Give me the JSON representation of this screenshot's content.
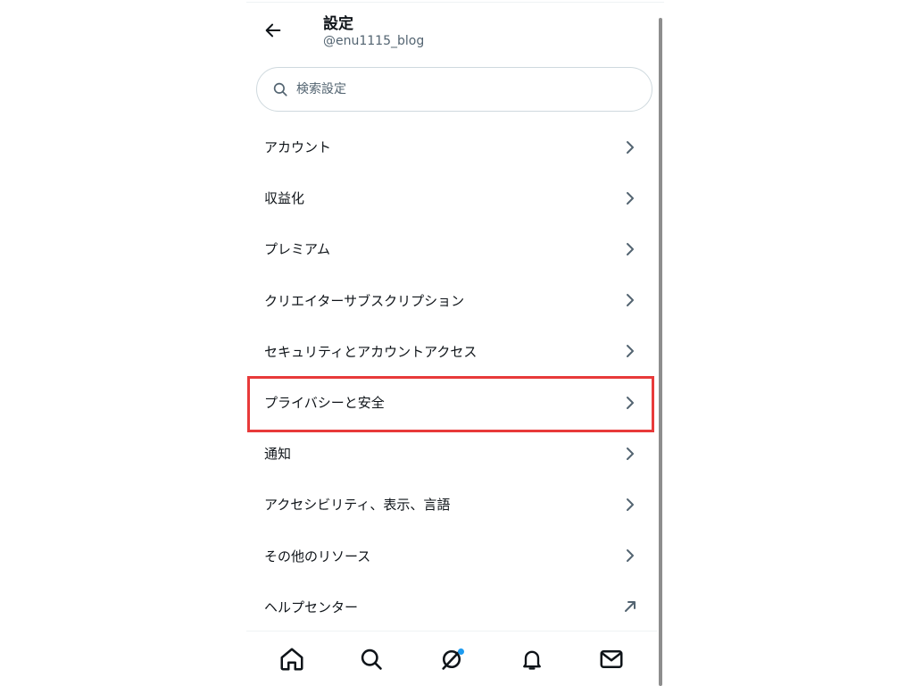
{
  "header": {
    "title": "設定",
    "handle": "@enu1115_blog"
  },
  "search": {
    "placeholder": "検索設定"
  },
  "menu": {
    "items": [
      {
        "label": "アカウント",
        "icon": "chevron-right-icon"
      },
      {
        "label": "収益化",
        "icon": "chevron-right-icon"
      },
      {
        "label": "プレミアム",
        "icon": "chevron-right-icon"
      },
      {
        "label": "クリエイターサブスクリプション",
        "icon": "chevron-right-icon"
      },
      {
        "label": "セキュリティとアカウントアクセス",
        "icon": "chevron-right-icon"
      },
      {
        "label": "プライバシーと安全",
        "icon": "chevron-right-icon",
        "highlighted": true
      },
      {
        "label": "通知",
        "icon": "chevron-right-icon"
      },
      {
        "label": "アクセシビリティ、表示、言語",
        "icon": "chevron-right-icon"
      },
      {
        "label": "その他のリソース",
        "icon": "chevron-right-icon"
      },
      {
        "label": "ヘルプセンター",
        "icon": "external-link-arrow-icon"
      }
    ]
  },
  "bottom_nav": {
    "items": [
      "home-icon",
      "search-icon",
      "grok-icon",
      "bell-icon",
      "mail-icon"
    ],
    "notification_dot_on": "grok-icon"
  },
  "colors": {
    "highlight_border": "#e83a3a",
    "accent": "#1d9bf0",
    "text": "#0f1419",
    "secondary_text": "#536471"
  }
}
